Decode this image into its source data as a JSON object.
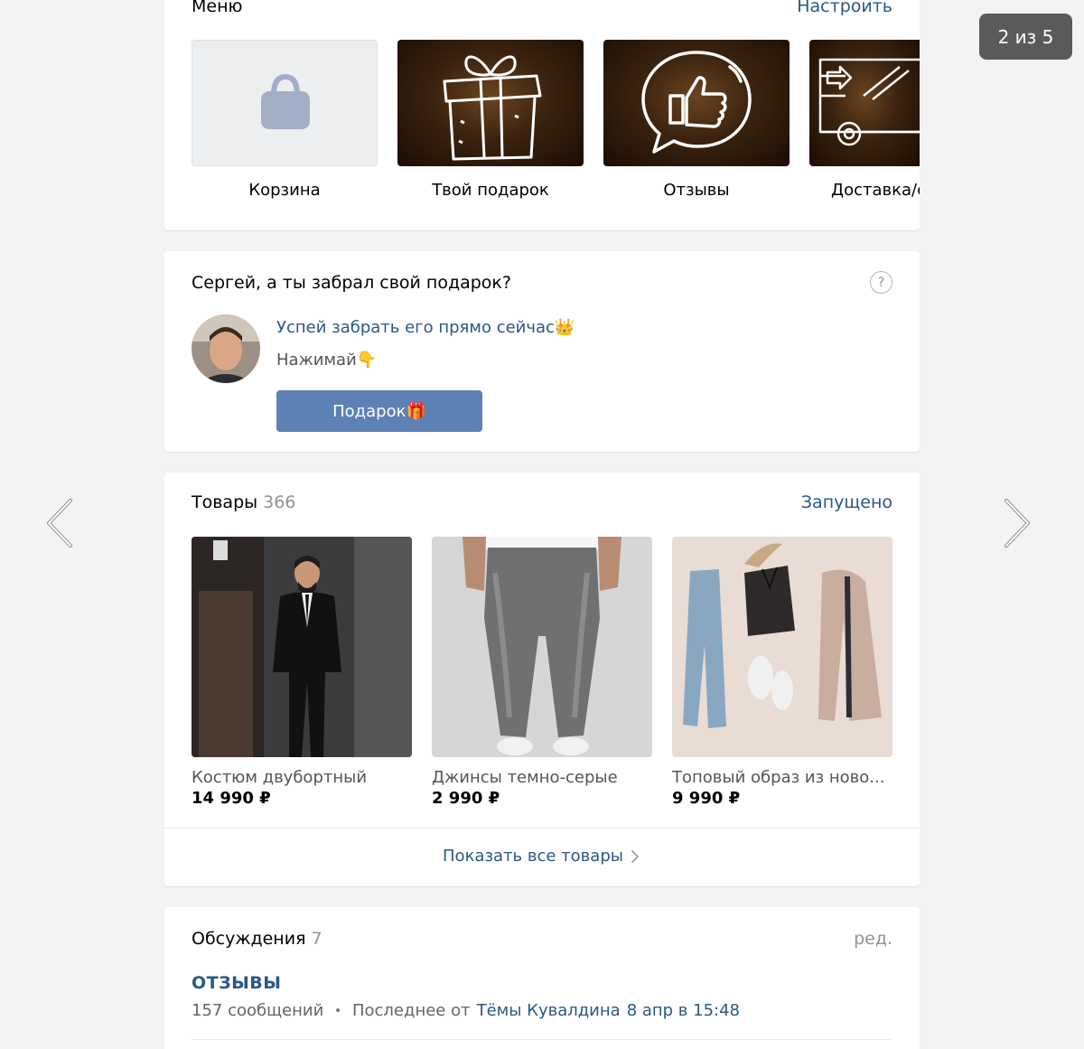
{
  "viewer": {
    "counter": "2 из 5"
  },
  "menu": {
    "title": "Меню",
    "action": "Настроить",
    "items": [
      {
        "label": "Корзина",
        "icon": "shopping-bag-icon"
      },
      {
        "label": "Твой подарок",
        "icon": "gift-box-icon"
      },
      {
        "label": "Отзывы",
        "icon": "thumbs-up-bubble-icon"
      },
      {
        "label": "Доставка/с",
        "icon": "delivery-truck-icon"
      }
    ]
  },
  "promo": {
    "title": "Сергей, а ты забрал свой подарок?",
    "help_icon": "?",
    "line1": "Успей забрать его прямо сейчас👑",
    "line2": "Нажимай👇",
    "button": "Подарок🎁"
  },
  "products": {
    "title": "Товары",
    "count": "366",
    "action": "Запущено",
    "items": [
      {
        "name": "Костюм двубортный",
        "price": "14 990 ₽"
      },
      {
        "name": "Джинсы темно-серые",
        "price": "2 990 ₽"
      },
      {
        "name": "Топовый образ из ново...",
        "price": "9 990 ₽"
      }
    ],
    "show_all": "Показать все товары"
  },
  "discussions": {
    "title": "Обсуждения",
    "count": "7",
    "action": "ред.",
    "topic": {
      "title": "ОТЗЫВЫ",
      "messages": "157 сообщений",
      "bullet": "•",
      "last_prefix": "Последнее от",
      "last_author": "Тёмы Кувалдина",
      "last_time": "8 апр в 15:48"
    }
  },
  "colors": {
    "link": "#2a5885",
    "button": "#5d81b4",
    "background": "#f3f3f4"
  }
}
